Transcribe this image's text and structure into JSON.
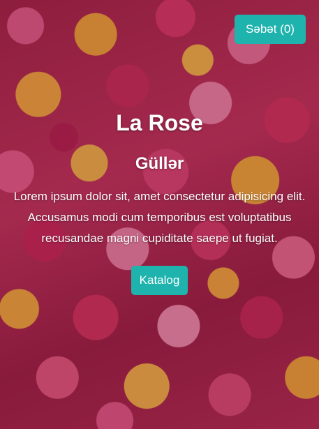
{
  "header": {
    "cart_label": "Səbət (0)"
  },
  "hero": {
    "title": "La Rose",
    "subtitle": "Güllər",
    "text": "Lorem ipsum dolor sit, amet consectetur adipisicing elit. Accusamus modi cum temporibus est voluptatibus recusandae magni cupiditate saepe ut fugiat.",
    "button_label": "Katalog",
    "background_image": "roses-background"
  },
  "colors": {
    "accent": "#1fb3ad",
    "text": "#ffffff"
  }
}
